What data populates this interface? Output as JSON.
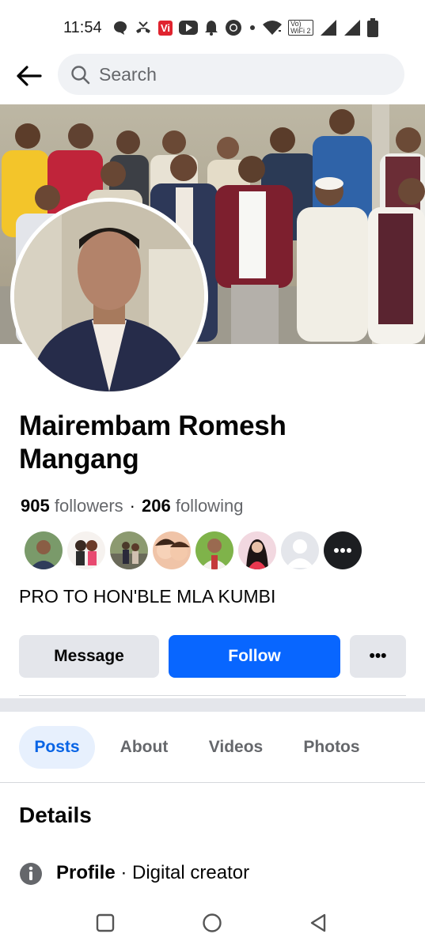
{
  "status_bar": {
    "time": "11:54",
    "icons": [
      "chat-bubble-icon",
      "missed-call-icon",
      "vi-app-icon",
      "youtube-icon",
      "bell-icon",
      "chrome-icon",
      "dot-icon",
      "wifi-icon",
      "volte-icon",
      "signal-icon",
      "signal-icon",
      "battery-icon"
    ],
    "vi_label": "Vi",
    "volte_label_top": "Vo)",
    "volte_label_bottom": "WiFi 2",
    "colors": {
      "vi": "#e0242f"
    }
  },
  "top_bar": {
    "back_icon": "arrow-left-icon",
    "search_placeholder": "Search"
  },
  "profile": {
    "name": "Mairembam Romesh Mangang",
    "followers_count": "905",
    "followers_label": "followers",
    "following_count": "206",
    "following_label": "following",
    "bio": "PRO TO HON'BLE MLA KUMBI"
  },
  "actions": {
    "message_label": "Message",
    "follow_label": "Follow",
    "more_label": "•••",
    "colors": {
      "follow": "#0866ff",
      "secondary": "#e4e6eb"
    }
  },
  "tabs": [
    {
      "label": "Posts",
      "active": true
    },
    {
      "label": "About",
      "active": false
    },
    {
      "label": "Videos",
      "active": false
    },
    {
      "label": "Photos",
      "active": false
    }
  ],
  "details": {
    "title": "Details",
    "profile_label": "Profile",
    "profile_separator": " · ",
    "profile_value": "Digital creator"
  },
  "nav_bar": {
    "icons": [
      "recent-apps-icon",
      "home-icon",
      "back-icon"
    ]
  }
}
